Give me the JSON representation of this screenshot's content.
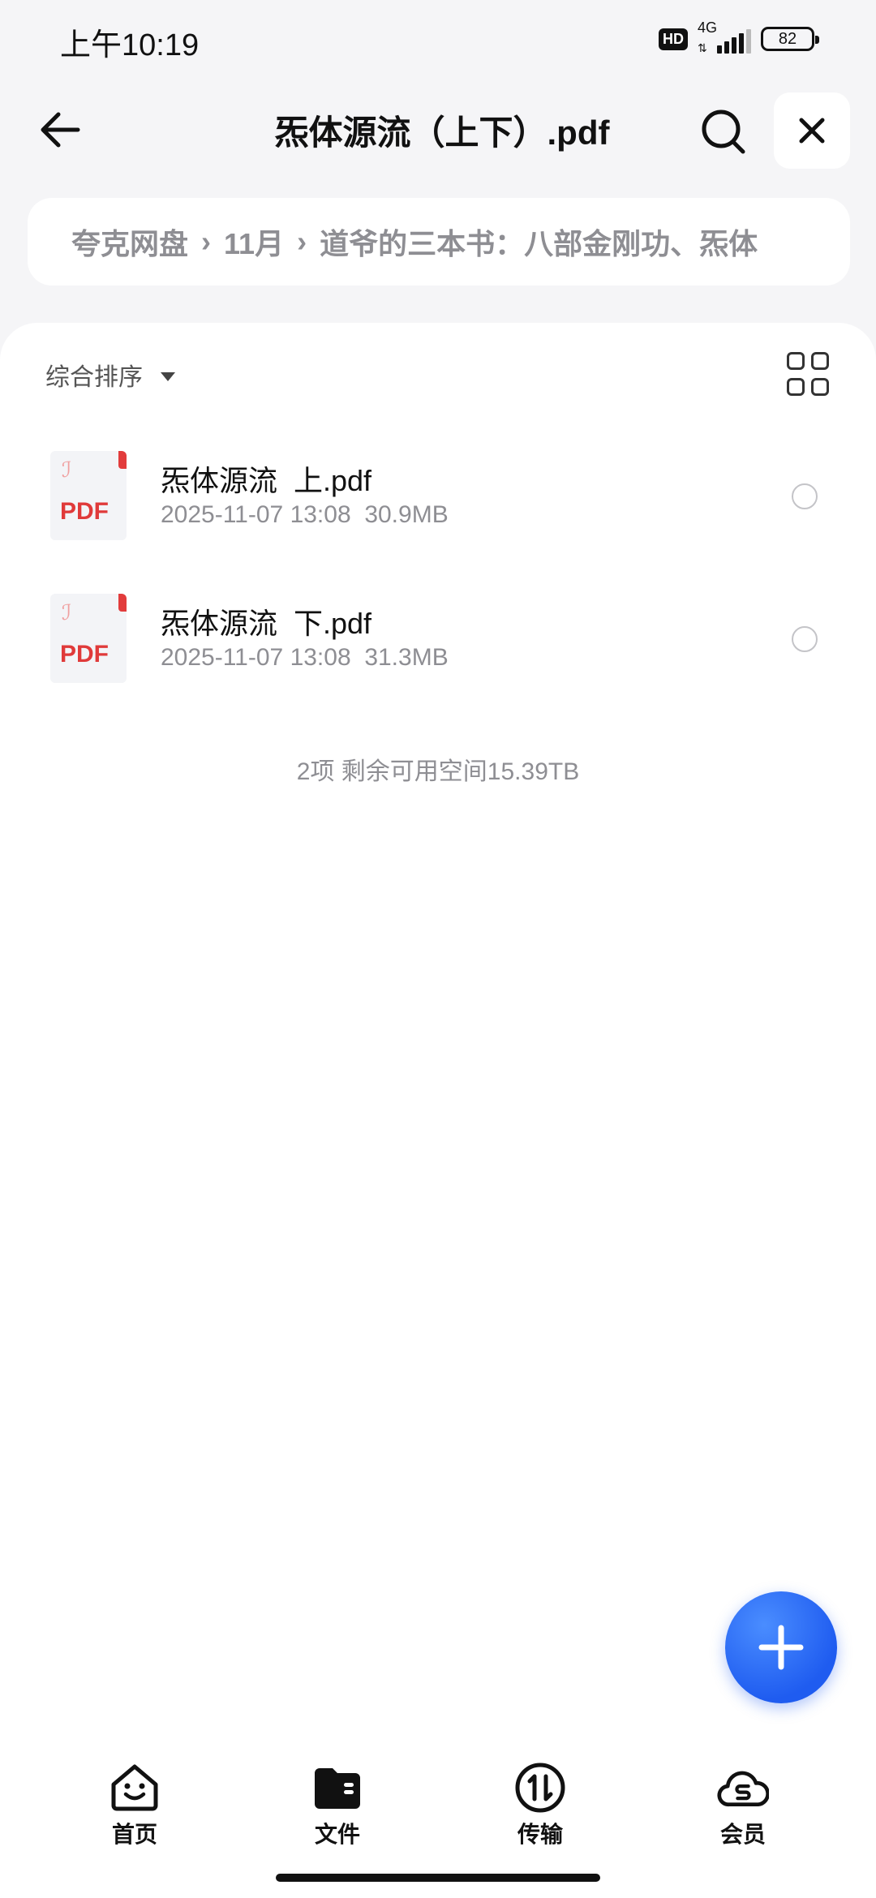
{
  "status_bar": {
    "time": "上午10:19",
    "hd": "HD",
    "network": "4G",
    "battery": "82"
  },
  "header": {
    "title": "炁体源流（上下）.pdf",
    "back_icon": "arrow-left-icon",
    "search_icon": "search-icon",
    "close_icon": "close-icon"
  },
  "breadcrumb": [
    "夸克网盘",
    "11月",
    "道爷的三本书：八部金刚功、炁体"
  ],
  "toolbar": {
    "sort_label": "综合排序",
    "view_icon": "grid-view-icon"
  },
  "files": [
    {
      "name": "炁体源流  上.pdf",
      "date": "2025-11-07 13:08",
      "size": "30.9MB",
      "icon_text": "PDF"
    },
    {
      "name": "炁体源流  下.pdf",
      "date": "2025-11-07 13:08",
      "size": "31.3MB",
      "icon_text": "PDF"
    }
  ],
  "footer_info": "2项 剩余可用空间15.39TB",
  "fab_icon": "plus-icon",
  "nav": [
    {
      "label": "首页",
      "icon": "smile-home-icon"
    },
    {
      "label": "文件",
      "icon": "folder-icon"
    },
    {
      "label": "传输",
      "icon": "transfer-icon"
    },
    {
      "label": "会员",
      "icon": "cloud-vip-icon"
    }
  ],
  "colors": {
    "accent": "#1f5cf0",
    "background": "#f5f5f7",
    "secondary_text": "#8e8e93",
    "pdf_red": "#e03a3a"
  }
}
